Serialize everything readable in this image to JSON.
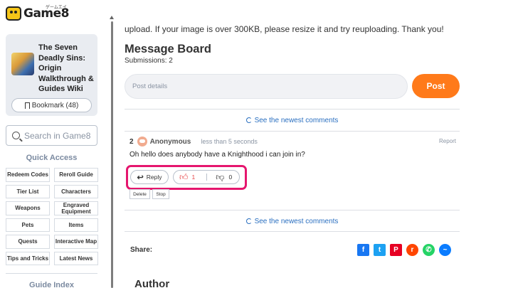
{
  "site": {
    "logo_text": "Game8",
    "logo_sub": "ゲームエイト"
  },
  "sidebar": {
    "game_title": "The Seven Deadly Sins: Origin Walkthrough & Guides Wiki",
    "bookmark_label": "Bookmark (48)",
    "search_placeholder": "Search in Game8",
    "quick_access_title": "Quick Access",
    "quick_access": [
      "Redeem Codes",
      "Reroll Guide",
      "Tier List",
      "Characters",
      "Weapons",
      "Engraved Equipment",
      "Pets",
      "Items",
      "Quests",
      "Interactive Map",
      "Tips and Tricks",
      "Latest News"
    ],
    "guide_index_title": "Guide Index"
  },
  "main": {
    "top_note": "upload. If your image is over 300KB, please resize it and try reuploading. Thank you!",
    "board_title": "Message Board",
    "submissions": "Submissions: 2",
    "post_placeholder": "Post details",
    "post_button": "Post",
    "newest_comments": "See the newest comments",
    "comment": {
      "number": "2",
      "author": "Anonymous",
      "time": "less than 5 seconds",
      "report": "Report",
      "body": "Oh hello does anybody have a Knighthood i can join in?",
      "reply_label": "Reply",
      "upvotes": "1",
      "downvotes": "0",
      "delete_label": "Delete",
      "stop_label": "Stop"
    },
    "share_label": "Share:",
    "author_heading": "Author"
  },
  "colors": {
    "accent_orange": "#ff7a1a",
    "highlight_pink": "#e5166e",
    "link_blue": "#2a6fc0"
  }
}
